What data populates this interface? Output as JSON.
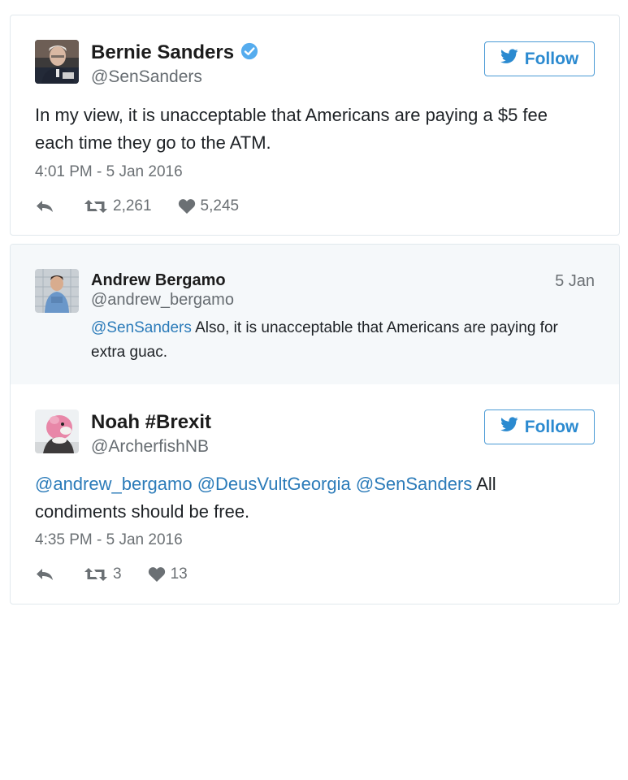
{
  "tweets": [
    {
      "name": "Bernie Sanders",
      "handle": "@SenSanders",
      "follow_label": "Follow",
      "text": "In my view, it is unacceptable that Americans are paying a $5 fee each time they go to the ATM.",
      "timestamp": "4:01 PM - 5 Jan 2016",
      "retweets": "2,261",
      "likes": "5,245"
    }
  ],
  "quoted_reply": {
    "name": "Andrew Bergamo",
    "handle": "@andrew_bergamo",
    "date": "5 Jan",
    "mention": "@SenSanders",
    "text": " Also, it is unacceptable that Americans are paying for extra guac."
  },
  "reply": {
    "name": "Noah #Brexit",
    "handle": "@ArcherfishNB",
    "follow_label": "Follow",
    "mentions": [
      "@andrew_bergamo",
      "@DeusVultGeorgia",
      "@SenSanders"
    ],
    "text": " All condiments should be free.",
    "timestamp": "4:35 PM - 5 Jan 2016",
    "retweets": "3",
    "likes": "13"
  },
  "colors": {
    "link": "#2b7bb9",
    "follow_border": "#4a9ad5",
    "verified": "#55acee",
    "muted": "#6b7074",
    "quote_bg": "#f5f8fa"
  },
  "icons": [
    "verified-badge-icon",
    "twitter-bird-icon",
    "reply-icon",
    "retweet-icon",
    "heart-icon"
  ]
}
